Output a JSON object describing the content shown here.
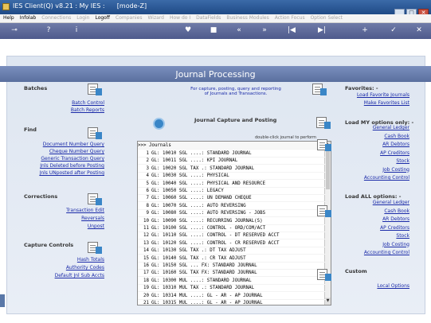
{
  "window": {
    "title": "IES Client(Q) v8.21 : My IES :      [mode-Z]"
  },
  "menu": [
    {
      "label": "Help",
      "enabled": true
    },
    {
      "label": "Infolab",
      "enabled": true
    },
    {
      "label": "Connections",
      "enabled": false
    },
    {
      "label": "Login",
      "enabled": false
    },
    {
      "label": "Logoff",
      "enabled": true
    },
    {
      "label": "Companies",
      "enabled": false
    },
    {
      "label": "Wizard",
      "enabled": false
    },
    {
      "label": "How do I",
      "enabled": false
    },
    {
      "label": "DataFields",
      "enabled": false
    },
    {
      "label": "Business Modules",
      "enabled": false
    },
    {
      "label": "Action Focus",
      "enabled": false
    },
    {
      "label": "Option Select",
      "enabled": false
    }
  ],
  "toolbar_icons": [
    "key-icon",
    "help-icon",
    "info-icon",
    "blank",
    "blank",
    "blank",
    "heart-icon",
    "stop-icon",
    "back-icon",
    "forward-icon",
    "first-icon",
    "last-icon",
    "plus-icon",
    "check-icon",
    "close-icon"
  ],
  "page": {
    "heading": "Journal Processing"
  },
  "left": {
    "batches": {
      "title": "Batches",
      "links": [
        "Batch Control",
        "Batch Reports"
      ]
    },
    "find": {
      "title": "Find",
      "links": [
        "Document Number Query",
        "Cheque Number Query",
        "Generic Transaction Query",
        "Jnls Deleted before Posting",
        "Jnls UNposted after Posting"
      ]
    },
    "corrections": {
      "title": "Corrections",
      "links": [
        "Transaction Edit",
        "Reversals",
        "Unpost"
      ]
    },
    "capture": {
      "title": "Capture Controls",
      "links": [
        "Hash Totals",
        "Authority Codes",
        "Default Jnl Sub Accts"
      ]
    }
  },
  "center": {
    "info": "For capture, posting, query and reporting of Journals and Transactions.",
    "capture_title": "Journal Capture and Posting",
    "hint": "double-click journal to perform",
    "header_row": ">>> Journals",
    "journals": [
      "GL: 10010 SGL ....: STANDARD JOURNAL",
      "GL: 10011 SGL ....: KPI JOURNAL",
      "GL: 10020 SGL TAX .: STANDARD JOURNAL",
      "GL: 10030 SGL ....: PHYSICAL",
      "GL: 10040 SGL ....: PHYSICAL AND RESOURCE",
      "GL: 10050 SGL ....: LEGACY",
      "GL: 10060 SGL ....: UN DEMAND CHEQUE",
      "GL: 10070 SGL ....: AUTO REVERSING",
      "GL: 10080 SGL ....: AUTO REVERSING - JOBS",
      "GL: 10090 SGL ....: RECURRING JOURNAL(S)",
      "GL: 10100 SGL ....: CONTROL - ORD/COM/ACT",
      "GL: 10110 SGL ....: CONTROL - DT RESERVED ACCT",
      "GL: 10120 SGL ....: CONTROL - CR RESERVED ACCT",
      "GL: 10130 SGL TAX .: DT TAX ADJUST",
      "GL: 10140 SGL TAX .: CR TAX ADJUST",
      "GL: 10150 SGL ... FX: STANDARD JOURNAL",
      "GL: 10160 SGL TAX FX: STANDARD JOURNAL",
      "GL: 10300 MUL ....: STANDARD JOURNAL",
      "GL: 10310 MUL TAX .: STANDARD JOURNAL",
      "GL: 10314 MUL ....: GL - AR - AP JOURNAL",
      "GL: 10315 MUL ....: GL - AR - AP JOURNAL"
    ]
  },
  "right": {
    "favorites": {
      "title": "Favorites: -",
      "links": [
        "Load Favorite Journals",
        "Make Favorites List"
      ]
    },
    "my_options": {
      "title": "Load MY options only: -",
      "links": [
        "General Ledger",
        "Cash Book",
        "AR Debtors",
        "AP Creditors",
        "Stock",
        "Job Costing",
        "Accounting Control"
      ]
    },
    "all_options": {
      "title": "Load ALL options: -",
      "links": [
        "General Ledger",
        "Cash Book",
        "AR Debtors",
        "AP Creditors",
        "Stock",
        "Job Costing",
        "Accounting Control"
      ]
    },
    "custom": {
      "title": "Custom",
      "links": [
        "Local Options"
      ]
    }
  }
}
